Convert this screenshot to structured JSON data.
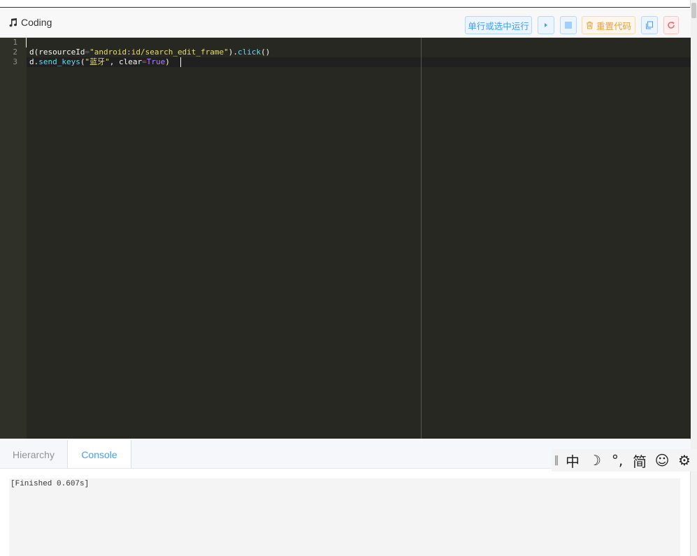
{
  "header": {
    "title": "Coding",
    "run_selection_label": "单行或选中运行",
    "reset_code_label": "重置代码"
  },
  "editor": {
    "line_numbers": [
      "1",
      "2",
      "3"
    ],
    "lines": [
      "",
      "d(resourceId=\"android:id/search_edit_frame\").click()",
      "d.send_keys(\"蓝牙\", clear=True)"
    ]
  },
  "tabs": [
    "Hierarchy",
    "Console"
  ],
  "active_tab": "Console",
  "console": {
    "output": "[Finished 0.607s]"
  },
  "ime_toolbar": {
    "items": [
      "中",
      "☽",
      "°,",
      "简",
      "☺",
      "⚙"
    ]
  }
}
